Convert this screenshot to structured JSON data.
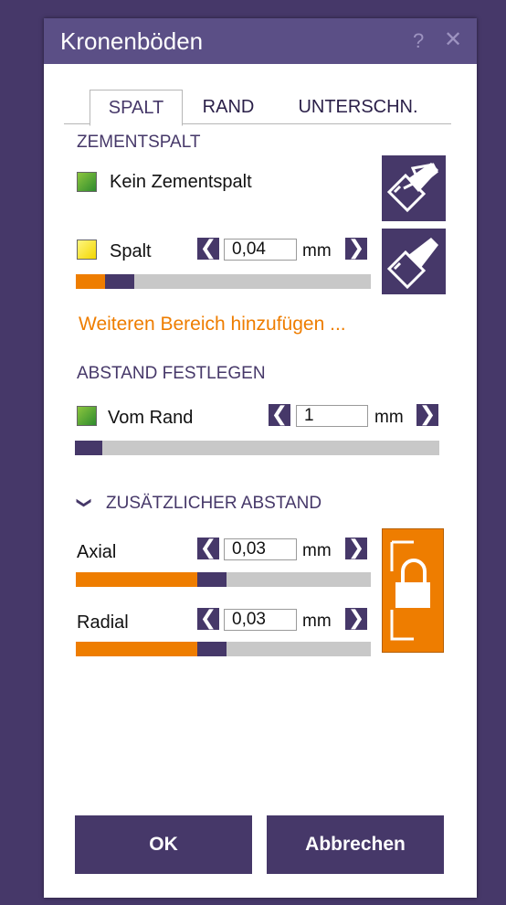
{
  "dialog": {
    "title": "Kronenböden",
    "help_label": "?",
    "close_label": "✕"
  },
  "tabs": [
    {
      "label": "SPALT",
      "active": true
    },
    {
      "label": "RAND",
      "active": false
    },
    {
      "label": "UNTERSCHN.",
      "active": false
    }
  ],
  "zementspalt": {
    "heading": "ZEMENTSPALT",
    "kein_label": "Kein Zementspalt",
    "spalt_label": "Spalt",
    "spalt_value": "0,04",
    "unit": "mm",
    "spalt_level": 0.2,
    "add_link": "Weiteren Bereich hinzufügen ..."
  },
  "abstand": {
    "heading": "ABSTAND FESTLEGEN",
    "vom_rand_label": "Vom Rand",
    "vom_rand_value": "1",
    "unit": "mm",
    "level": 0.08
  },
  "zusaetzlich": {
    "chevron": "❯",
    "heading": "ZUSÄTZLICHER ABSTAND",
    "axial_label": "Axial",
    "axial_value": "0,03",
    "radial_label": "Radial",
    "radial_value": "0,03",
    "unit": "mm",
    "axial_level": 0.51,
    "radial_level": 0.51
  },
  "arrows": {
    "left": "❮",
    "right": "❯"
  },
  "buttons": {
    "ok": "OK",
    "cancel": "Abbrechen"
  },
  "colors": {
    "brand_purple": "#463869",
    "title_bar": "#5b4f86",
    "accent_orange": "#ee7d00",
    "swatch_green": "#5aa832",
    "swatch_yellow": "#f9e62a"
  }
}
